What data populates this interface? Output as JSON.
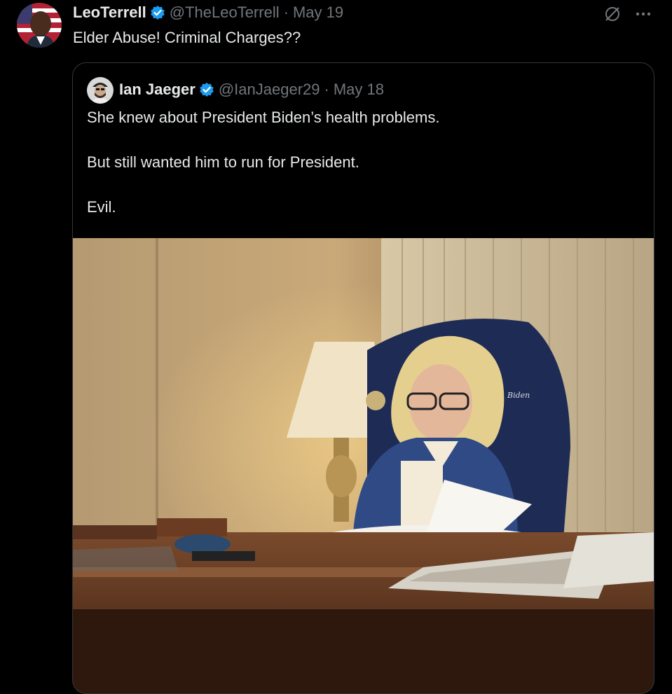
{
  "tweet": {
    "author": {
      "display_name": "LeoTerrell",
      "handle": "@TheLeoTerrell",
      "verified": true
    },
    "separator": "·",
    "date": "May 19",
    "text": "Elder Abuse! Criminal Charges??",
    "icons": [
      "grok-icon",
      "more-options-icon"
    ]
  },
  "quoted_tweet": {
    "author": {
      "display_name": "Ian Jaeger",
      "handle": "@IanJaeger29",
      "verified": true
    },
    "separator": "·",
    "date": "May 18",
    "text_lines": [
      "She knew about President Biden’s health problems.",
      "But still wanted him to run for President.",
      "Evil."
    ],
    "photo": {
      "chair_monogram": "Biden"
    }
  },
  "colors": {
    "background": "#000000",
    "text_primary": "#e7e9ea",
    "text_secondary": "#71767b",
    "verified_blue": "#1d9bf0",
    "card_border": "#333639"
  }
}
